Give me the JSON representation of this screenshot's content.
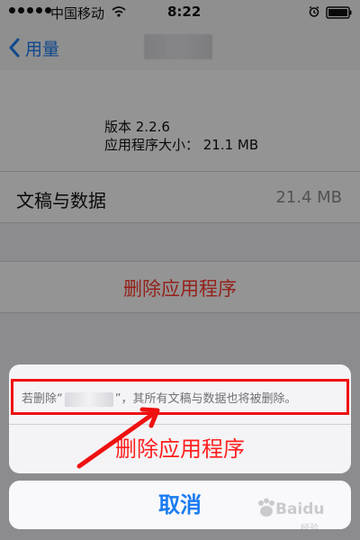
{
  "status_bar": {
    "carrier": "中国移动",
    "time": "8:22",
    "icons": {
      "wifi": "wifi-icon",
      "alarm": "alarm-icon",
      "battery": "battery-icon"
    }
  },
  "nav": {
    "back_label": "用量",
    "back_icon": "chevron-left-icon"
  },
  "app_info": {
    "version": "版本 2.2.6",
    "size": "应用程序大小：  21.1 MB"
  },
  "documents": {
    "label": "文稿与数据",
    "size": "21.4 MB"
  },
  "delete_app": {
    "label": "删除应用程序"
  },
  "action_sheet": {
    "message_prefix": "若删除“",
    "message_suffix": "”，其所有文稿与数据也将被删除。",
    "delete_label": "删除应用程序"
  },
  "cancel": {
    "label": "取消"
  },
  "watermark": {
    "brand": "Baidu",
    "text": "经验"
  },
  "colors": {
    "ios_blue": "#1a7cf2",
    "delete_red": "#ff3b30",
    "annotation_red": "#ef1010"
  }
}
